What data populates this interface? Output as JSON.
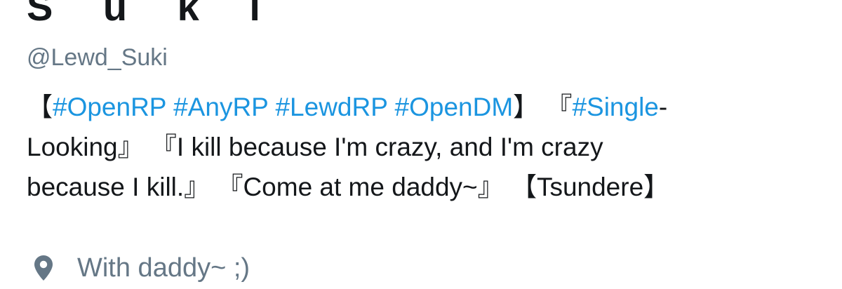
{
  "profile": {
    "display_name": "S u k i",
    "handle": "@Lewd_Suki",
    "bio": {
      "line1": {
        "open_bracket": "【",
        "tag1": "#OpenRP",
        "sp1": " ",
        "tag2": "#AnyRP",
        "sp2": " ",
        "tag3": "#LewdRP",
        "sp3": " ",
        "tag4": "#OpenDM",
        "mid": "】 『",
        "tag5": "#Single",
        "tail": "-"
      },
      "line2": "Looking』 『I kill because I'm crazy, and I'm crazy",
      "line3": "because I kill.』 『Come at me daddy~』 【Tsundere】"
    },
    "location": {
      "icon": "location-pin-icon",
      "text": "With daddy~ ;)"
    }
  },
  "colors": {
    "text": "#14171a",
    "secondary": "#657786",
    "link": "#1b95e0",
    "background": "#ffffff"
  }
}
